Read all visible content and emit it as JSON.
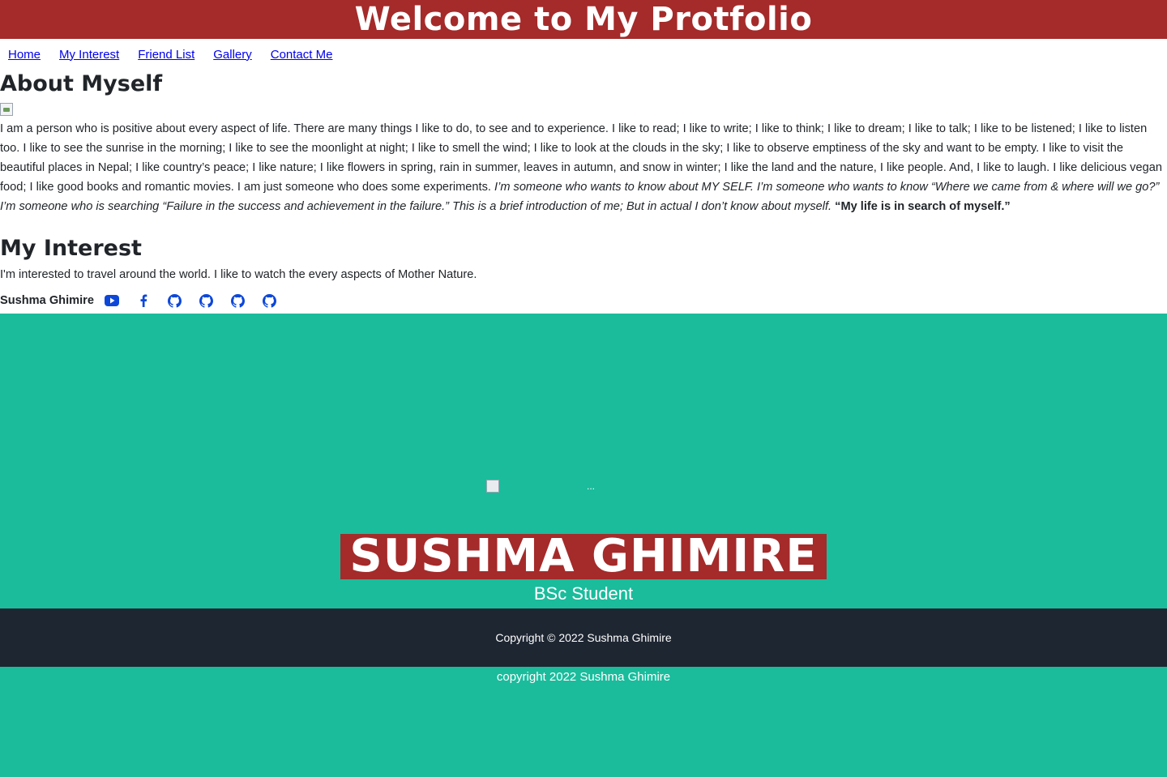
{
  "header": {
    "title": "Welcome to My Protfolio"
  },
  "nav": [
    {
      "label": "Home"
    },
    {
      "label": "My Interest"
    },
    {
      "label": "Friend List"
    },
    {
      "label": "Gallery"
    },
    {
      "label": "Contact Me"
    }
  ],
  "about": {
    "title": "About Myself",
    "paragraph_plain": "I am a person who is positive about every aspect of life. There are many things I like to do, to see and to experience. I like to read; I like to write; I like to think; I like to dream; I like to talk; I like to be listened; I like to listen too. I like to see the sunrise in the morning; I like to see the moonlight at night; I like to smell the wind; I like to look at the clouds in the sky; I like to observe emptiness of the sky and want to be empty. I like to visit the beautiful places in Nepal; I like country’s peace; I like nature; I like flowers in spring, rain in summer, leaves in autumn, and snow in winter; I like the land and the nature, I like people. And, I like to laugh. I like delicious vegan food; I like good books and romantic movies. I am just someone who does some experiments. ",
    "paragraph_italic": "I’m someone who wants to know about MY SELF. I’m someone who wants to know “Where we came from & where will we go?” I’m someone who is searching “Failure in the success and achievement in the failure.” This is a brief introduction of me; But in actual I don’t know about myself. ",
    "paragraph_bold": "“My life is in search of myself.”"
  },
  "interest": {
    "title": "My Interest",
    "text": "I'm interested to travel around the world. I like to watch the every aspects of Mother Nature."
  },
  "social": {
    "name": "Sushma Ghimire",
    "icons": [
      "youtube-icon",
      "facebook-icon",
      "github-icon",
      "github-icon",
      "github-icon",
      "github-icon"
    ]
  },
  "hero": {
    "image_alt": "...",
    "name": "SUSHMA GHIMIRE",
    "role": "BSc Student"
  },
  "footer": {
    "bar_text": "Copyright © 2022 Sushma Ghimire",
    "copyright": "copyright 2022 Sushma Ghimire"
  },
  "colors": {
    "header_bg": "#a52a2a",
    "hero_bg": "#1abc9c",
    "footer_bg": "#1e2632",
    "link": "#0000ee",
    "icon": "#0d47d9"
  }
}
